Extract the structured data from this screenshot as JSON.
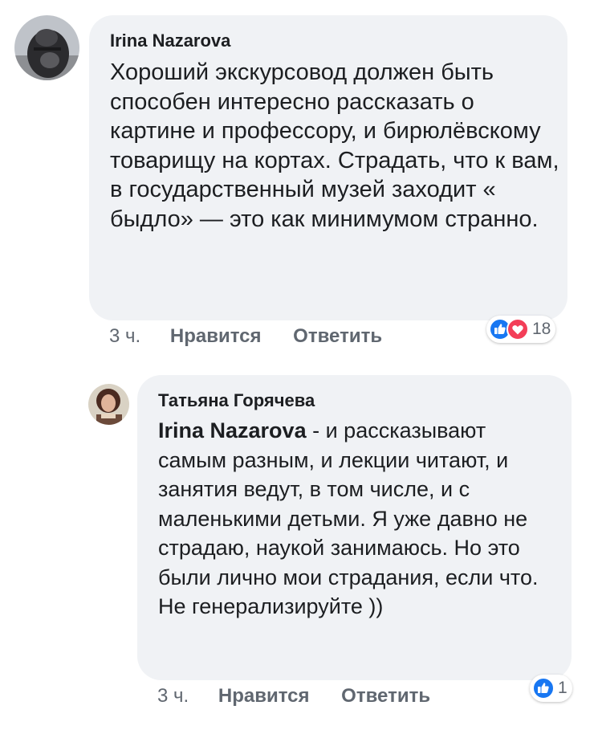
{
  "comments": [
    {
      "author": "Irina Nazarova",
      "text": "Хороший экскурсовод должен быть способен интересно рассказать о картине и профессору, и бирюлёвскому товарищу на кортах. Страдать, что к вам, в государственный музей заходит « быдло» — это как минимумом странно.",
      "time": "3 ч.",
      "like_label": "Нравится",
      "reply_label": "Ответить",
      "reaction_count": "18",
      "reactions": [
        "like-icon",
        "love-icon"
      ]
    },
    {
      "author": "Татьяна Горячева",
      "mention": "Irina Nazarova",
      "text": " - и рассказывают самым разным, и лекции читают, и занятия ведут, в том числе, и с маленькими детьми. Я уже давно не страдаю, наукой занимаюсь. Но это были лично мои страдания, если что. Не генерализируйте ))",
      "time": "3 ч.",
      "like_label": "Нравится",
      "reply_label": "Ответить",
      "reaction_count": "1",
      "reactions": [
        "like-icon"
      ]
    }
  ],
  "colors": {
    "bubble": "#f0f2f5",
    "like_blue": "#1877f2",
    "love_red": "#f33e58",
    "meta_gray": "#606770"
  }
}
